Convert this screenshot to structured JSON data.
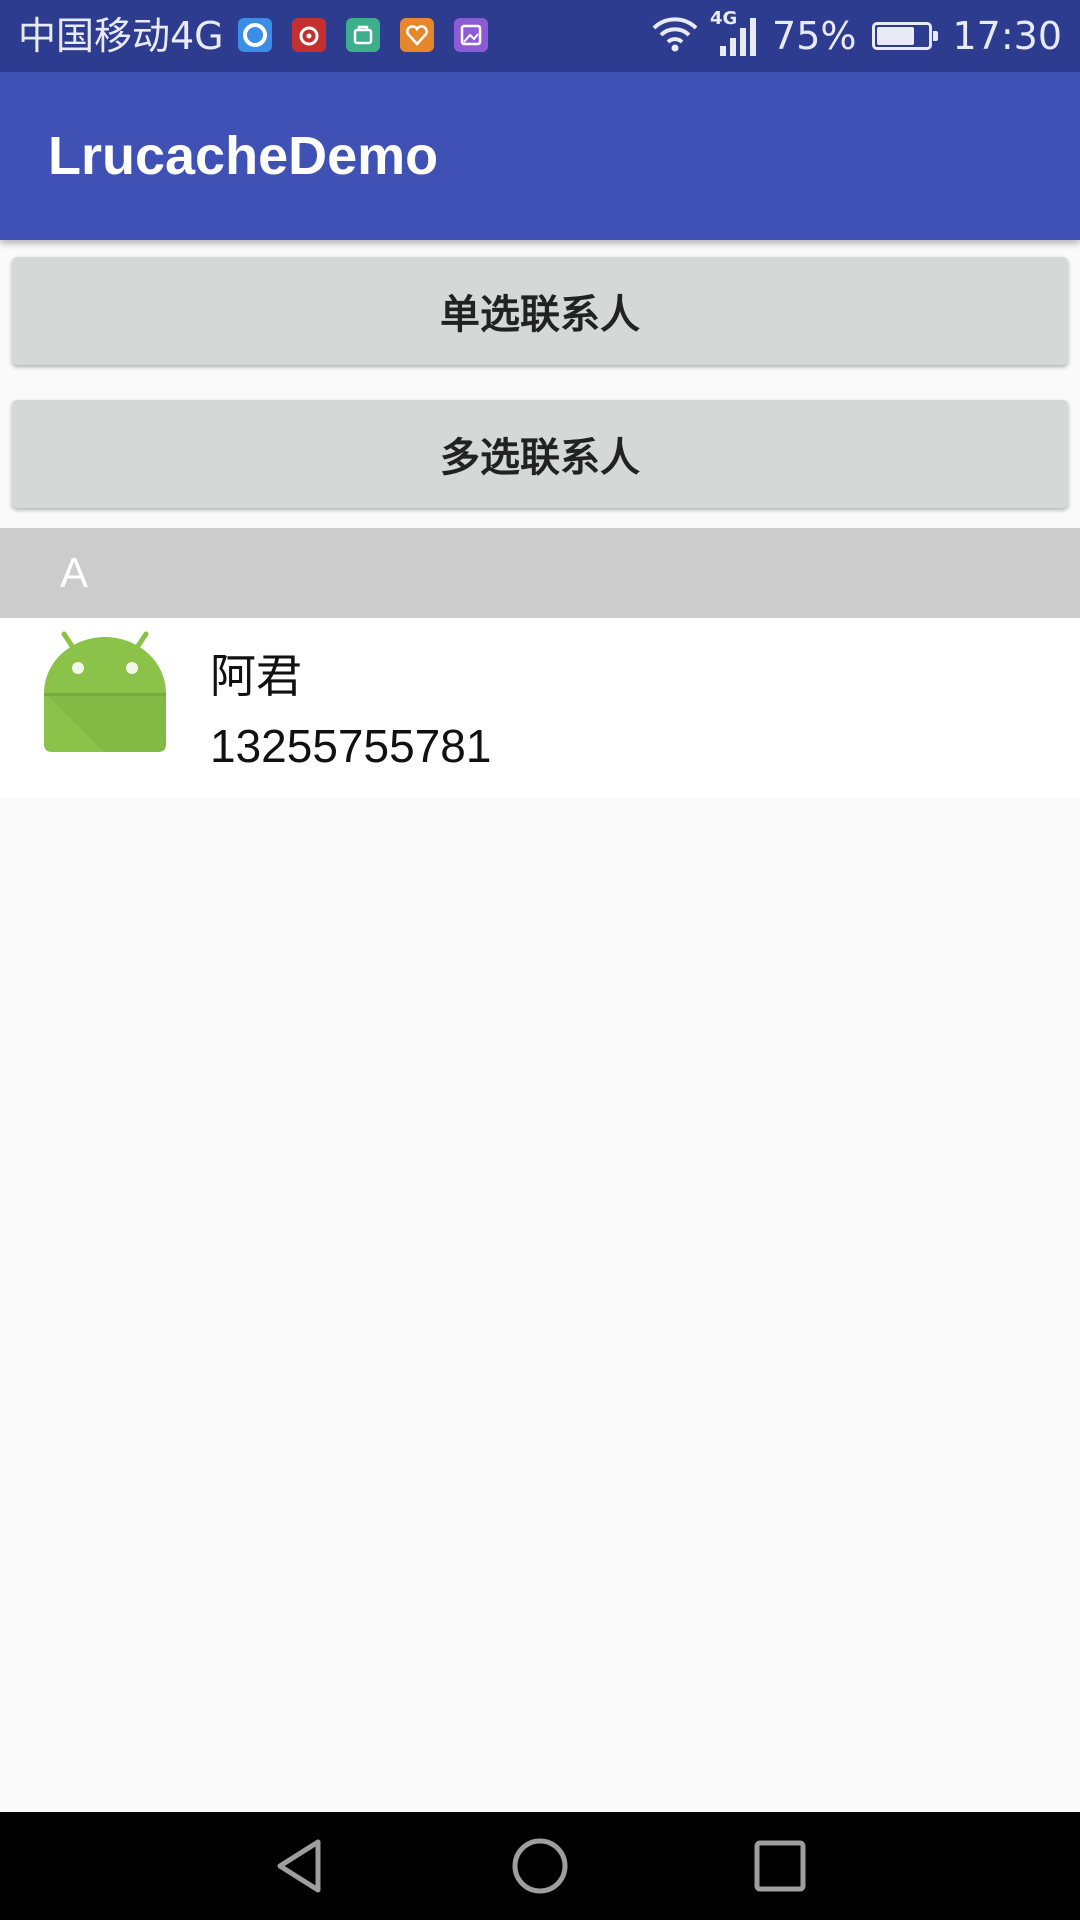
{
  "status_bar": {
    "carrier": "中国移动4G",
    "notification_icons": [
      "browser-icon",
      "netease-music-icon",
      "bag-app-icon",
      "health-app-icon",
      "gallery-app-icon"
    ],
    "network_badge": "4G",
    "battery_percent": "75%",
    "battery_level": 0.75,
    "time": "17:30"
  },
  "app_bar": {
    "title": "LrucacheDemo",
    "color": "#3F51B5"
  },
  "buttons": {
    "single_select": "单选联系人",
    "multi_select": "多选联系人"
  },
  "contacts": {
    "section_letter": "A",
    "items": [
      {
        "name": "阿君",
        "phone": "13255755781",
        "avatar": "android-avatar-icon"
      }
    ]
  },
  "nav_bar": {
    "icons": [
      "back-icon",
      "home-icon",
      "recents-icon"
    ]
  },
  "colors": {
    "status_bar": "#2D3C8F",
    "primary": "#3F51B5",
    "button": "#D6D7D7",
    "section_header": "#CCCCCC",
    "android_green": "#8BC34A",
    "background": "#FAFAFA"
  }
}
